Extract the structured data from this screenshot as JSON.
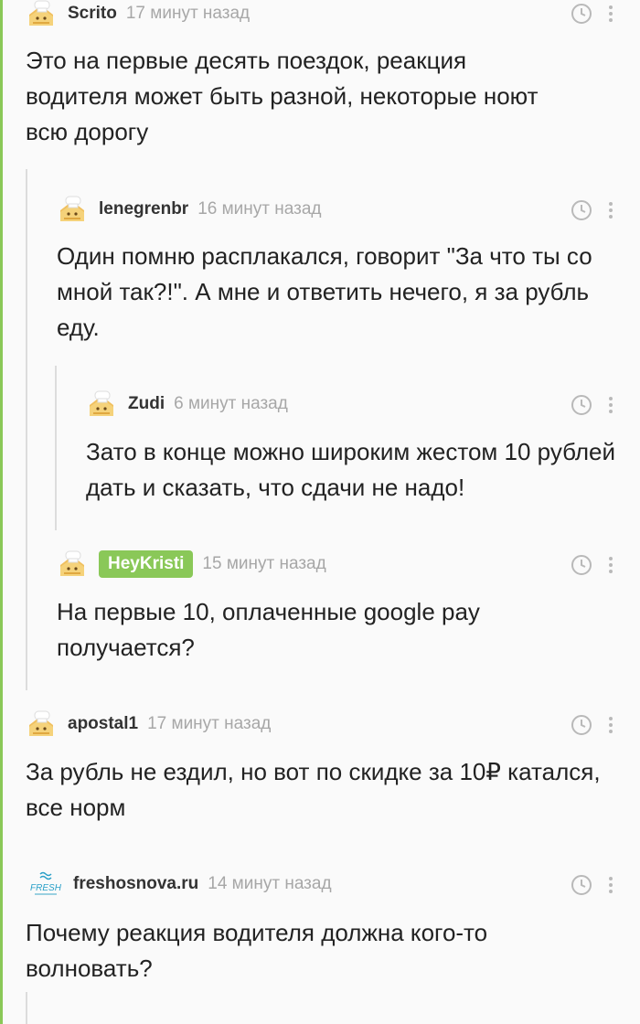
{
  "comments": [
    {
      "username": "Scrito",
      "time": "17 минут назад",
      "text": "Это на первые десять поездок, реакция водителя может быть разной, некоторые ноют всю дорогу"
    },
    {
      "username": "lenegrenbr",
      "time": "16 минут назад",
      "text": "Один помню расплакался, говорит \"За что ты со мной так?!\". А мне и ответить нечего, я за рубль еду."
    },
    {
      "username": "Zudi",
      "time": "6 минут назад",
      "text": "Зато в конце можно широким жестом 10 рублей дать и сказать, что сдачи не надо!"
    },
    {
      "username": "HeyKristi",
      "time": "15 минут назад",
      "text": "На первые 10, оплаченные google pay получается?"
    },
    {
      "username": "apostal1",
      "time": "17 минут назад",
      "text": "За рубль не ездил, но вот по скидке за 10₽ катался, все норм"
    },
    {
      "username": "freshosnova.ru",
      "time": "14 минут назад",
      "text": "Почему реакция водителя должна кого-то волновать?"
    }
  ],
  "fresh_logo_text": "FRESH",
  "colors": {
    "accent": "#8ac858",
    "thread_line": "#dcdcdc",
    "meta": "#a7a7a7"
  },
  "icons": {
    "avatar": "default-avatar-icon",
    "clock": "clock-icon",
    "menu": "kebab-menu-icon"
  }
}
